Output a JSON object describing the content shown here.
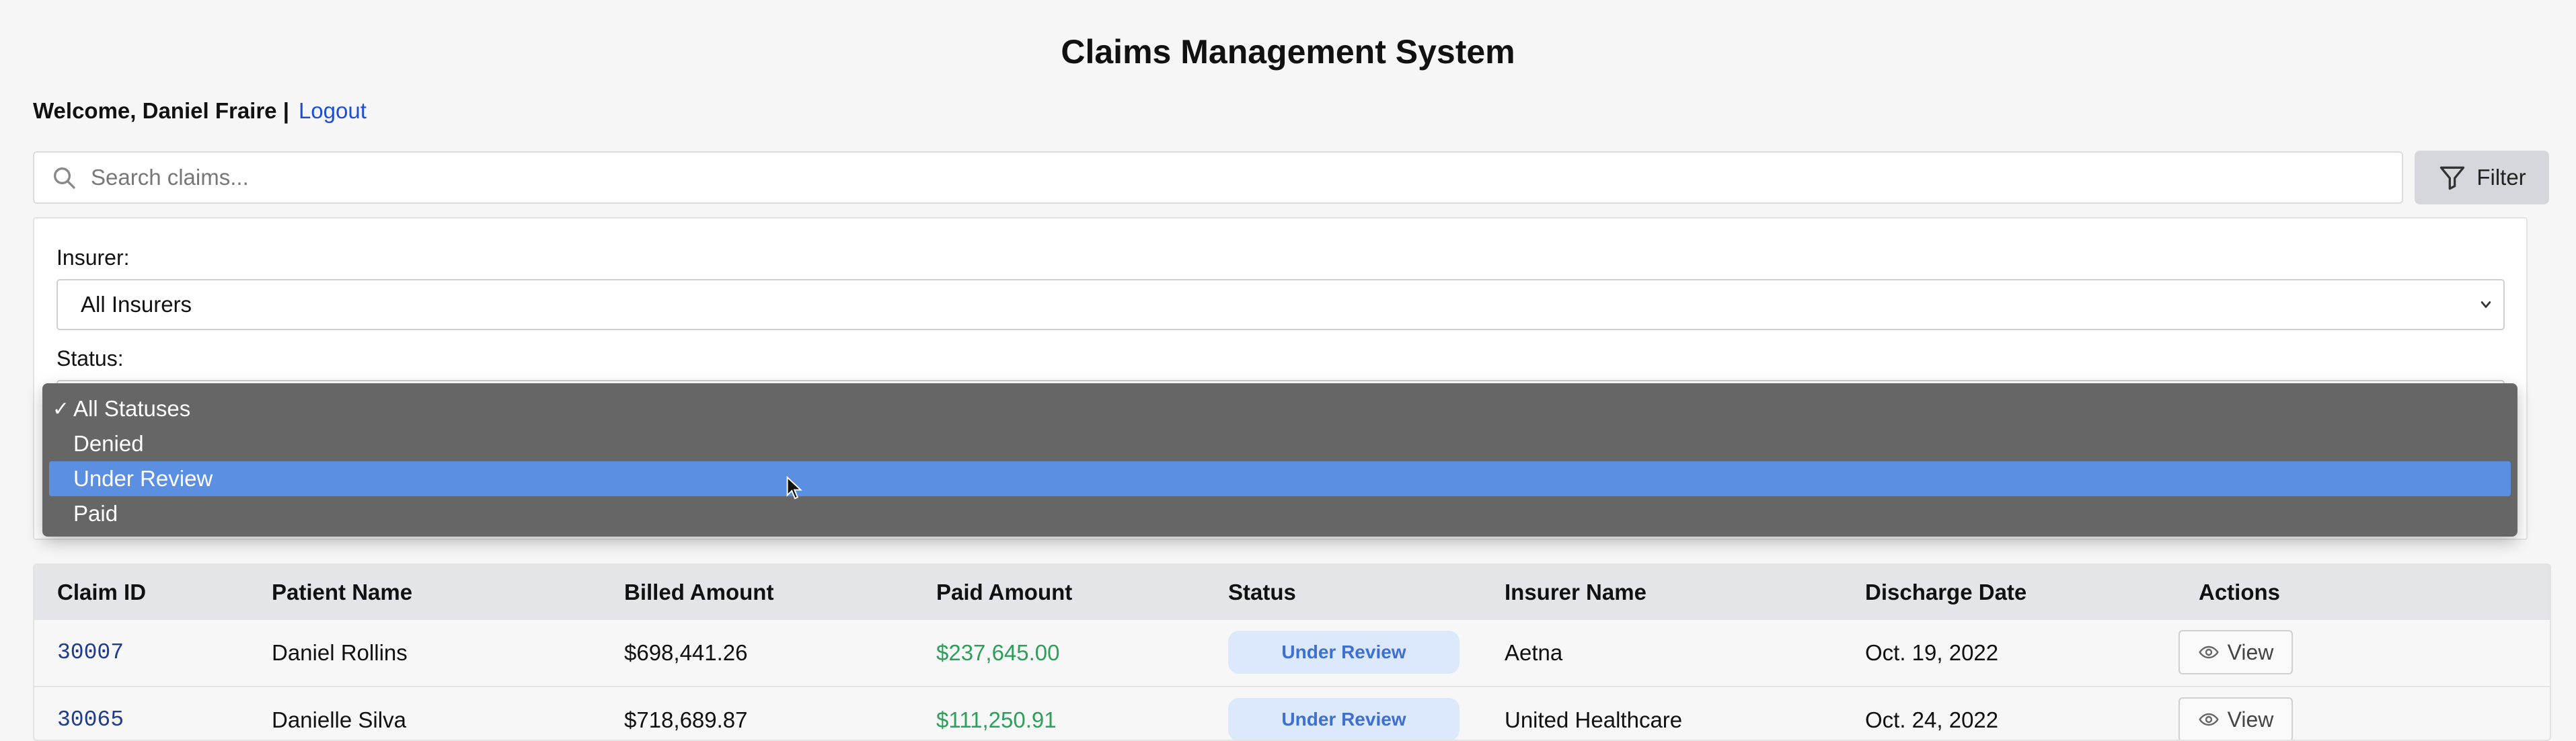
{
  "header": {
    "title": "Claims Management System",
    "welcome": "Welcome, Daniel Fraire |",
    "logout": "Logout"
  },
  "search": {
    "placeholder": "Search claims...",
    "value": ""
  },
  "filter_button": {
    "label": "Filter",
    "icon": "filter-icon"
  },
  "filters": {
    "insurer_label": "Insurer:",
    "insurer_value": "All Insurers",
    "status_label": "Status:"
  },
  "status_dropdown": {
    "options": [
      {
        "label": "All Statuses",
        "checked": true
      },
      {
        "label": "Denied"
      },
      {
        "label": "Under Review",
        "highlighted": true
      },
      {
        "label": "Paid"
      }
    ]
  },
  "table": {
    "columns": [
      "Claim ID",
      "Patient Name",
      "Billed Amount",
      "Paid Amount",
      "Status",
      "Insurer Name",
      "Discharge Date",
      "Actions"
    ],
    "rows": [
      {
        "claim_id": "30007",
        "patient": "Daniel Rollins",
        "billed": "$698,441.26",
        "paid": "$237,645.00",
        "status": "Under Review",
        "insurer": "Aetna",
        "discharge": "Oct. 19, 2022",
        "action": "View"
      },
      {
        "claim_id": "30065",
        "patient": "Danielle Silva",
        "billed": "$718,689.87",
        "paid": "$111,250.91",
        "status": "Under Review",
        "insurer": "United Healthcare",
        "discharge": "Oct. 24, 2022",
        "action": "View"
      }
    ]
  },
  "colors": {
    "accent": "#1d4ed8",
    "paid_text": "#2e9e5b",
    "status_badge_bg": "#dce8fb",
    "status_badge_text": "#3f6fcf",
    "dropdown_bg": "#666666",
    "dropdown_highlight": "#5b8fe2"
  }
}
